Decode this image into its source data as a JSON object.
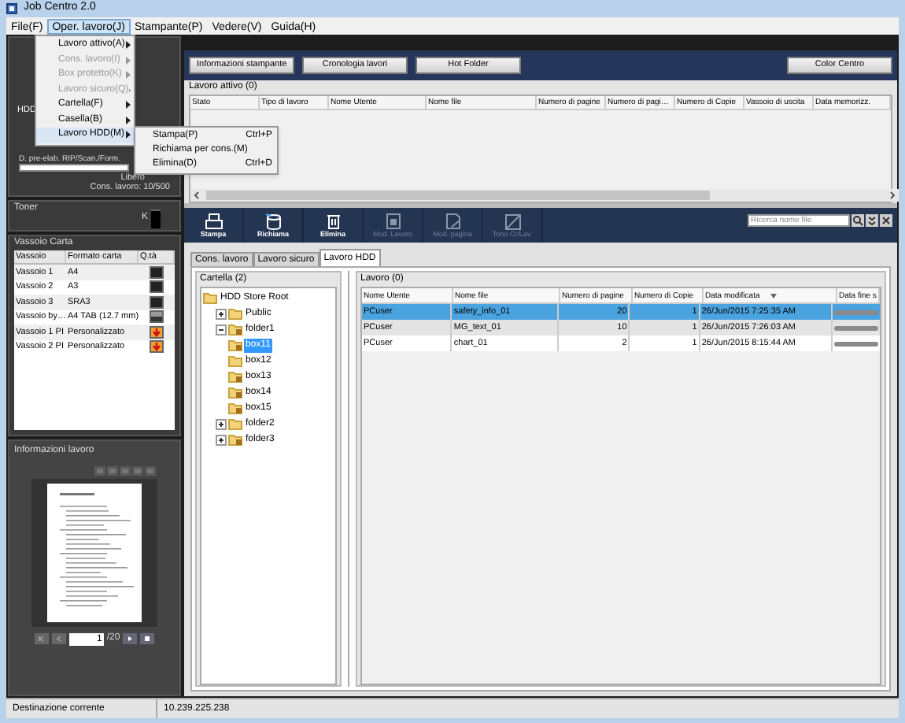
{
  "window": {
    "title": "Job Centro 2.0"
  },
  "menu_bar": [
    {
      "label": "File(F)",
      "selected": false
    },
    {
      "label": "Oper. lavoro(J)",
      "selected": true
    },
    {
      "label": "Stampante(P)",
      "selected": false
    },
    {
      "label": "Vedere(V)",
      "selected": false
    },
    {
      "label": "Guida(H)",
      "selected": false
    }
  ],
  "open_menu": [
    {
      "label": "Lavoro attivo(A)",
      "disabled": false,
      "selected": false
    },
    {
      "label": "Cons. lavoro(I)",
      "disabled": true,
      "selected": false
    },
    {
      "label": "Box protetto(K)",
      "disabled": true,
      "selected": false
    },
    {
      "label": "Lavoro sicuro(Q)",
      "disabled": true,
      "selected": false
    },
    {
      "label": "Cartella(F)",
      "disabled": false,
      "selected": false
    },
    {
      "label": "Casella(B)",
      "disabled": false,
      "selected": false
    },
    {
      "label": "Lavoro HDD(M)",
      "disabled": false,
      "selected": true
    }
  ],
  "submenu": [
    {
      "label": "Stampa(P)",
      "shortcut": "Ctrl+P"
    },
    {
      "label": "Richiama per cons.(M)"
    },
    {
      "label": "Elimina(D)",
      "shortcut": "Ctrl+D"
    }
  ],
  "printer_status": {
    "label": "HDD",
    "caption": "D. pre-elab. RIP/Scan./Form.",
    "free": "Libero",
    "stored_jobs": "Cons. lavoro: 10/500"
  },
  "toner": {
    "title": "Toner",
    "color_label": "K",
    "level": 0.9
  },
  "paper_trays": {
    "title": "Vassoio Carta",
    "columns": [
      "Vassoio",
      "Formato carta",
      "Q.tà"
    ],
    "rows": [
      {
        "tray": "Vassoio 1",
        "size": "A4",
        "kind": "full"
      },
      {
        "tray": "Vassoio 2",
        "size": "A3",
        "kind": "full"
      },
      {
        "tray": "Vassoio 3",
        "size": "SRA3",
        "kind": "full"
      },
      {
        "tray": "Vassoio by…",
        "size": "A4 TAB (12.7 mm)",
        "kind": "partial"
      },
      {
        "tray": "Vassoio 1 PI",
        "size": "Personalizzato",
        "kind": "error"
      },
      {
        "tray": "Vassoio 2 PI",
        "size": "Personalizzato",
        "kind": "error"
      }
    ]
  },
  "job_info": {
    "title": "Informazioni lavoro",
    "page": "1",
    "total": "/20"
  },
  "top_buttons": [
    "Informazioni stampante",
    "Cronologia lavori",
    "Hot Folder",
    "Color Centro"
  ],
  "active_jobs": {
    "title": "Lavoro attivo (0)",
    "columns": [
      "Stato",
      "Tipo di lavoro",
      "Nome Utente",
      "Nome file",
      "Numero di pagine",
      "Numero di pagi…",
      "Numero di Copie",
      "Vassoio di uscita",
      "Data memorizz."
    ]
  },
  "toolbar": {
    "buttons": [
      {
        "label": "Stampa",
        "kind": "print",
        "disabled": false
      },
      {
        "label": "Richiama",
        "kind": "recall",
        "disabled": false
      },
      {
        "label": "Elimina",
        "kind": "delete",
        "disabled": false
      },
      {
        "label": "Mod. Lavoro",
        "kind": "edit-job",
        "disabled": true
      },
      {
        "label": "Mod. pagina",
        "kind": "edit-page",
        "disabled": true
      },
      {
        "label": "Tono Cr/Lav.",
        "kind": "tone",
        "disabled": true
      }
    ],
    "search": {
      "placeholder": "Ricerca nome file"
    }
  },
  "tabs": [
    {
      "label": "Cons. lavoro",
      "selected": false
    },
    {
      "label": "Lavoro sicuro",
      "selected": false
    },
    {
      "label": "Lavoro HDD",
      "selected": true
    }
  ],
  "folders": {
    "title": "Cartella (2)",
    "tree": [
      {
        "label": "HDD Store Root",
        "locked": false,
        "selected": false,
        "children": [
          {
            "label": "Public",
            "locked": false,
            "selected": false,
            "expanded": false
          },
          {
            "label": "folder1",
            "locked": true,
            "selected": false,
            "expanded": true,
            "children": [
              {
                "label": "box11",
                "locked": true,
                "selected": true
              },
              {
                "label": "box12",
                "locked": false,
                "selected": false
              },
              {
                "label": "box13",
                "locked": true,
                "selected": false
              },
              {
                "label": "box14",
                "locked": true,
                "selected": false
              },
              {
                "label": "box15",
                "locked": true,
                "selected": false
              }
            ]
          },
          {
            "label": "folder2",
            "locked": false,
            "selected": false,
            "expanded": false
          },
          {
            "label": "folder3",
            "locked": true,
            "selected": false,
            "expanded": false
          }
        ]
      }
    ]
  },
  "jobs": {
    "title": "Lavoro (0)",
    "columns": [
      {
        "label": "Nome Utente",
        "sorted": false
      },
      {
        "label": "Nome file",
        "sorted": false
      },
      {
        "label": "Numero di pagine",
        "sorted": false
      },
      {
        "label": "Numero di Copie",
        "sorted": false
      },
      {
        "label": "Data modificata",
        "sorted": true
      },
      {
        "label": "Data fine s",
        "sorted": false
      }
    ],
    "rows": [
      {
        "user": "PCuser",
        "file": "safety_info_01",
        "pages": "20",
        "copies": "1",
        "modified": "26/Jun/2015 7:25:35 AM",
        "selected": true
      },
      {
        "user": "PCuser",
        "file": "MG_text_01",
        "pages": "10",
        "copies": "1",
        "modified": "26/Jun/2015 7:26:03 AM",
        "selected": false
      },
      {
        "user": "PCuser",
        "file": "chart_01",
        "pages": "2",
        "copies": "1",
        "modified": "26/Jun/2015 8:15:44 AM",
        "selected": false
      }
    ]
  },
  "status_bar": {
    "label": "Destinazione corrente",
    "value": "10.239.225.238"
  }
}
